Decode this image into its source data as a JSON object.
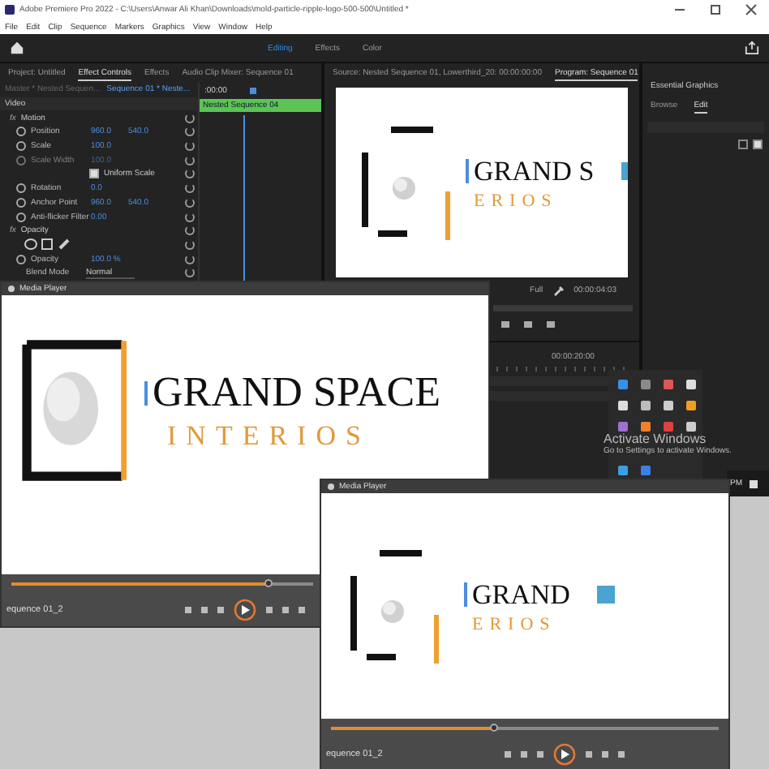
{
  "app_window": {
    "title": "Adobe Premiere Pro 2022 - C:\\Users\\Anwar Ali Khan\\Downloads\\mold-particle-ripple-logo-500-500\\Untitled *",
    "menu": [
      "File",
      "Edit",
      "Clip",
      "Sequence",
      "Markers",
      "Graphics",
      "View",
      "Window",
      "Help"
    ],
    "workspaces": [
      {
        "label": "Editing",
        "selected": true
      },
      {
        "label": "Effects",
        "selected": false
      },
      {
        "label": "Color",
        "selected": false
      }
    ]
  },
  "effect_panel": {
    "tabs": [
      {
        "label": "Project: Untitled",
        "selected": false
      },
      {
        "label": "Effect Controls",
        "selected": true
      },
      {
        "label": "Effects",
        "selected": false
      },
      {
        "label": "Audio Clip Mixer: Sequence 01",
        "selected": false
      }
    ],
    "master": "Master * Nested Sequen...",
    "clip": "Sequence 01 * Neste...",
    "time": ":00:00",
    "section": "Video",
    "clip_bar": "Nested Sequence 04",
    "rows": [
      {
        "kind": "group",
        "icon": "fx",
        "label": "Motion"
      },
      {
        "kind": "param",
        "label": "Position",
        "values": [
          "960.0",
          "540.0"
        ],
        "disabled": false
      },
      {
        "kind": "param",
        "label": "Scale",
        "values": [
          "100.0"
        ],
        "disabled": false
      },
      {
        "kind": "param",
        "label": "Scale Width",
        "values": [
          "100.0"
        ],
        "disabled": true
      },
      {
        "kind": "checkbox",
        "label": "Uniform Scale",
        "checked": true
      },
      {
        "kind": "param",
        "label": "Rotation",
        "values": [
          "0.0"
        ],
        "disabled": false
      },
      {
        "kind": "param",
        "label": "Anchor Point",
        "values": [
          "960.0",
          "540.0"
        ],
        "disabled": false
      },
      {
        "kind": "param",
        "label": "Anti-flicker Filter",
        "values": [
          "0.00"
        ],
        "disabled": false
      },
      {
        "kind": "group",
        "icon": "fx",
        "label": "Opacity"
      },
      {
        "kind": "tools"
      },
      {
        "kind": "param",
        "label": "Opacity",
        "values": [
          "100.0 %"
        ],
        "disabled": false
      },
      {
        "kind": "select",
        "label": "Blend Mode",
        "value": "Normal"
      }
    ]
  },
  "monitor_panel": {
    "tabs": [
      {
        "label": "Source: Nested Sequence 01, Lowerthird_20: 00:00:00:00",
        "selected": false
      },
      {
        "label": "Program: Sequence 01",
        "selected": true
      }
    ],
    "logo": {
      "kind": "brackets",
      "title": "GRAND S",
      "subtitle": "ERIOS",
      "accent_square": true
    },
    "zoom": "Full",
    "timecode": "00:00:04:03",
    "timeline_time": "00:00:20:00"
  },
  "graphics_panel": {
    "title": "Essential Graphics",
    "tabs": [
      {
        "label": "Browse",
        "selected": false
      },
      {
        "label": "Edit",
        "selected": true
      }
    ]
  },
  "tray": {
    "activate_title": "Activate Windows",
    "activate_text": "Go to Settings to activate Windows.",
    "clock": "PM"
  },
  "media_players": [
    {
      "title": "Media Player",
      "logo": {
        "kind": "frame",
        "title": "GRAND SPACE",
        "subtitle": "INTERIOS",
        "accent_square": false
      },
      "level": 0.85,
      "name": "equence 01_2"
    },
    {
      "title": "Media Player",
      "logo": {
        "kind": "brackets",
        "title": "GRAND",
        "subtitle": "ERIOS",
        "accent_square": true
      },
      "level": 0.42,
      "name": "equence 01_2"
    }
  ]
}
